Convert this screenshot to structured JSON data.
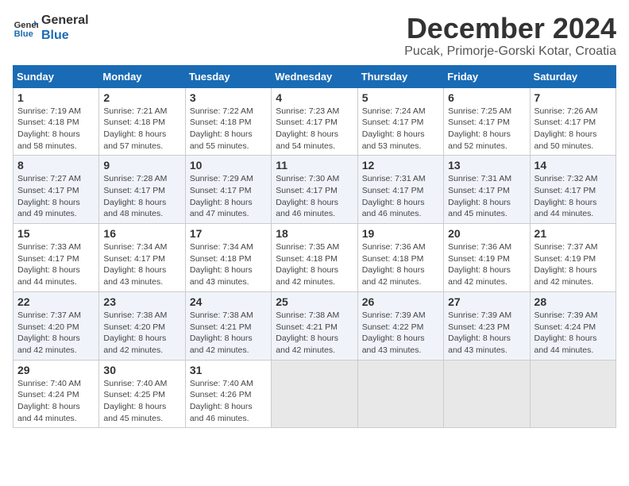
{
  "header": {
    "logo_line1": "General",
    "logo_line2": "Blue",
    "month": "December 2024",
    "location": "Pucak, Primorje-Gorski Kotar, Croatia"
  },
  "weekdays": [
    "Sunday",
    "Monday",
    "Tuesday",
    "Wednesday",
    "Thursday",
    "Friday",
    "Saturday"
  ],
  "weeks": [
    [
      {
        "day": "1",
        "sunrise": "7:19 AM",
        "sunset": "4:18 PM",
        "daylight": "8 hours and 58 minutes."
      },
      {
        "day": "2",
        "sunrise": "7:21 AM",
        "sunset": "4:18 PM",
        "daylight": "8 hours and 57 minutes."
      },
      {
        "day": "3",
        "sunrise": "7:22 AM",
        "sunset": "4:18 PM",
        "daylight": "8 hours and 55 minutes."
      },
      {
        "day": "4",
        "sunrise": "7:23 AM",
        "sunset": "4:17 PM",
        "daylight": "8 hours and 54 minutes."
      },
      {
        "day": "5",
        "sunrise": "7:24 AM",
        "sunset": "4:17 PM",
        "daylight": "8 hours and 53 minutes."
      },
      {
        "day": "6",
        "sunrise": "7:25 AM",
        "sunset": "4:17 PM",
        "daylight": "8 hours and 52 minutes."
      },
      {
        "day": "7",
        "sunrise": "7:26 AM",
        "sunset": "4:17 PM",
        "daylight": "8 hours and 50 minutes."
      }
    ],
    [
      {
        "day": "8",
        "sunrise": "7:27 AM",
        "sunset": "4:17 PM",
        "daylight": "8 hours and 49 minutes."
      },
      {
        "day": "9",
        "sunrise": "7:28 AM",
        "sunset": "4:17 PM",
        "daylight": "8 hours and 48 minutes."
      },
      {
        "day": "10",
        "sunrise": "7:29 AM",
        "sunset": "4:17 PM",
        "daylight": "8 hours and 47 minutes."
      },
      {
        "day": "11",
        "sunrise": "7:30 AM",
        "sunset": "4:17 PM",
        "daylight": "8 hours and 46 minutes."
      },
      {
        "day": "12",
        "sunrise": "7:31 AM",
        "sunset": "4:17 PM",
        "daylight": "8 hours and 46 minutes."
      },
      {
        "day": "13",
        "sunrise": "7:31 AM",
        "sunset": "4:17 PM",
        "daylight": "8 hours and 45 minutes."
      },
      {
        "day": "14",
        "sunrise": "7:32 AM",
        "sunset": "4:17 PM",
        "daylight": "8 hours and 44 minutes."
      }
    ],
    [
      {
        "day": "15",
        "sunrise": "7:33 AM",
        "sunset": "4:17 PM",
        "daylight": "8 hours and 44 minutes."
      },
      {
        "day": "16",
        "sunrise": "7:34 AM",
        "sunset": "4:17 PM",
        "daylight": "8 hours and 43 minutes."
      },
      {
        "day": "17",
        "sunrise": "7:34 AM",
        "sunset": "4:18 PM",
        "daylight": "8 hours and 43 minutes."
      },
      {
        "day": "18",
        "sunrise": "7:35 AM",
        "sunset": "4:18 PM",
        "daylight": "8 hours and 42 minutes."
      },
      {
        "day": "19",
        "sunrise": "7:36 AM",
        "sunset": "4:18 PM",
        "daylight": "8 hours and 42 minutes."
      },
      {
        "day": "20",
        "sunrise": "7:36 AM",
        "sunset": "4:19 PM",
        "daylight": "8 hours and 42 minutes."
      },
      {
        "day": "21",
        "sunrise": "7:37 AM",
        "sunset": "4:19 PM",
        "daylight": "8 hours and 42 minutes."
      }
    ],
    [
      {
        "day": "22",
        "sunrise": "7:37 AM",
        "sunset": "4:20 PM",
        "daylight": "8 hours and 42 minutes."
      },
      {
        "day": "23",
        "sunrise": "7:38 AM",
        "sunset": "4:20 PM",
        "daylight": "8 hours and 42 minutes."
      },
      {
        "day": "24",
        "sunrise": "7:38 AM",
        "sunset": "4:21 PM",
        "daylight": "8 hours and 42 minutes."
      },
      {
        "day": "25",
        "sunrise": "7:38 AM",
        "sunset": "4:21 PM",
        "daylight": "8 hours and 42 minutes."
      },
      {
        "day": "26",
        "sunrise": "7:39 AM",
        "sunset": "4:22 PM",
        "daylight": "8 hours and 43 minutes."
      },
      {
        "day": "27",
        "sunrise": "7:39 AM",
        "sunset": "4:23 PM",
        "daylight": "8 hours and 43 minutes."
      },
      {
        "day": "28",
        "sunrise": "7:39 AM",
        "sunset": "4:24 PM",
        "daylight": "8 hours and 44 minutes."
      }
    ],
    [
      {
        "day": "29",
        "sunrise": "7:40 AM",
        "sunset": "4:24 PM",
        "daylight": "8 hours and 44 minutes."
      },
      {
        "day": "30",
        "sunrise": "7:40 AM",
        "sunset": "4:25 PM",
        "daylight": "8 hours and 45 minutes."
      },
      {
        "day": "31",
        "sunrise": "7:40 AM",
        "sunset": "4:26 PM",
        "daylight": "8 hours and 46 minutes."
      },
      null,
      null,
      null,
      null
    ]
  ],
  "labels": {
    "sunrise": "Sunrise:",
    "sunset": "Sunset:",
    "daylight": "Daylight:"
  }
}
